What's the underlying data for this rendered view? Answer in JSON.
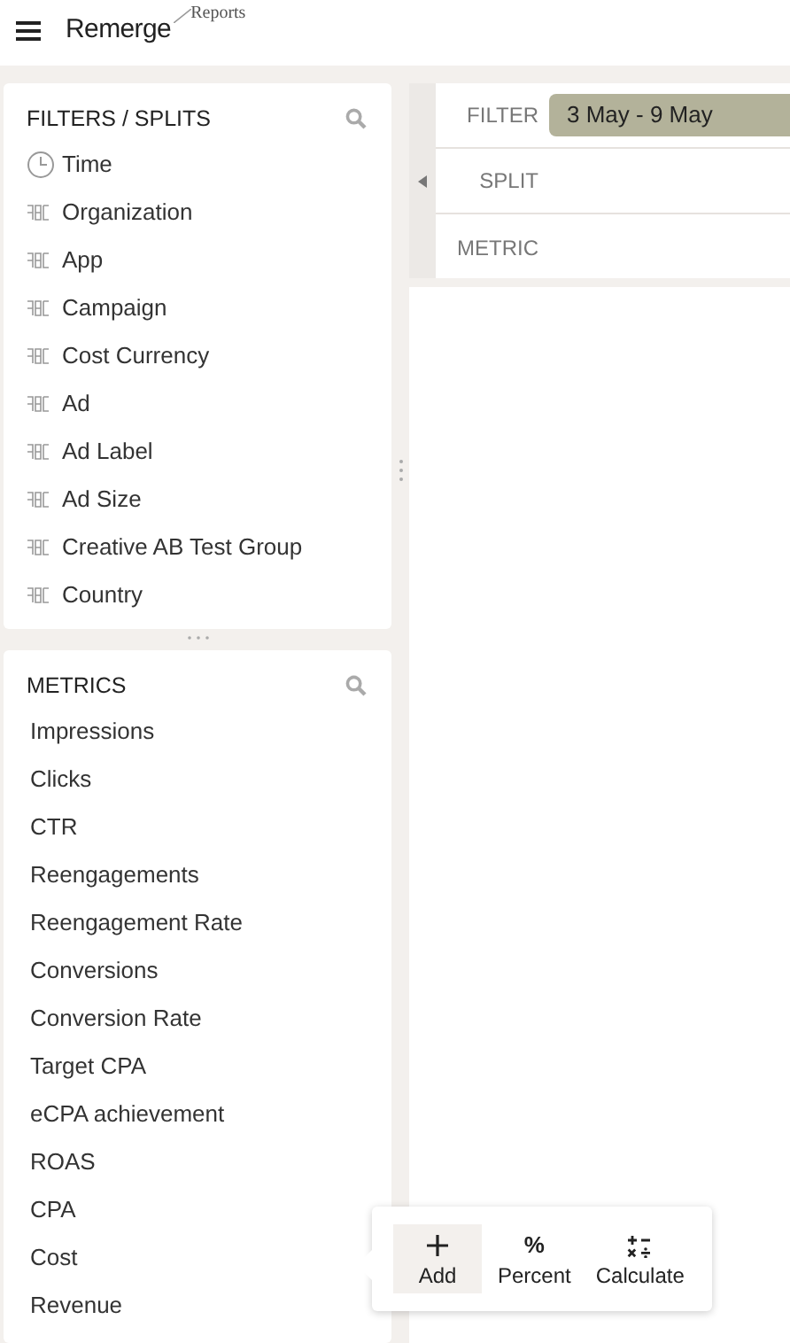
{
  "header": {
    "brand": "Remerge",
    "product": "Reports"
  },
  "filters_panel": {
    "title": "FILTERS / SPLITS",
    "items": [
      {
        "label": "Time",
        "kind": "time"
      },
      {
        "label": "Organization",
        "kind": "string"
      },
      {
        "label": "App",
        "kind": "string"
      },
      {
        "label": "Campaign",
        "kind": "string"
      },
      {
        "label": "Cost Currency",
        "kind": "string"
      },
      {
        "label": "Ad",
        "kind": "string"
      },
      {
        "label": "Ad Label",
        "kind": "string"
      },
      {
        "label": "Ad Size",
        "kind": "string"
      },
      {
        "label": "Creative AB Test Group",
        "kind": "string"
      },
      {
        "label": "Country",
        "kind": "string"
      }
    ]
  },
  "metrics_panel": {
    "title": "METRICS",
    "items": [
      "Impressions",
      "Clicks",
      "CTR",
      "Reengagements",
      "Reengagement Rate",
      "Conversions",
      "Conversion Rate",
      "Target CPA",
      "eCPA achievement",
      "ROAS",
      "CPA",
      "Cost",
      "Revenue"
    ]
  },
  "shelves": [
    {
      "label": "FILTER",
      "chips": [
        "3 May - 9 May"
      ]
    },
    {
      "label": "SPLIT"
    },
    {
      "label": "METRIC"
    }
  ],
  "popup": {
    "actions": [
      {
        "label": "Add",
        "kind": "plus",
        "selected": true
      },
      {
        "label": "Percent",
        "kind": "percent",
        "glyph": "%",
        "selected": false
      },
      {
        "label": "Calculate",
        "kind": "calc",
        "selected": false
      }
    ]
  }
}
